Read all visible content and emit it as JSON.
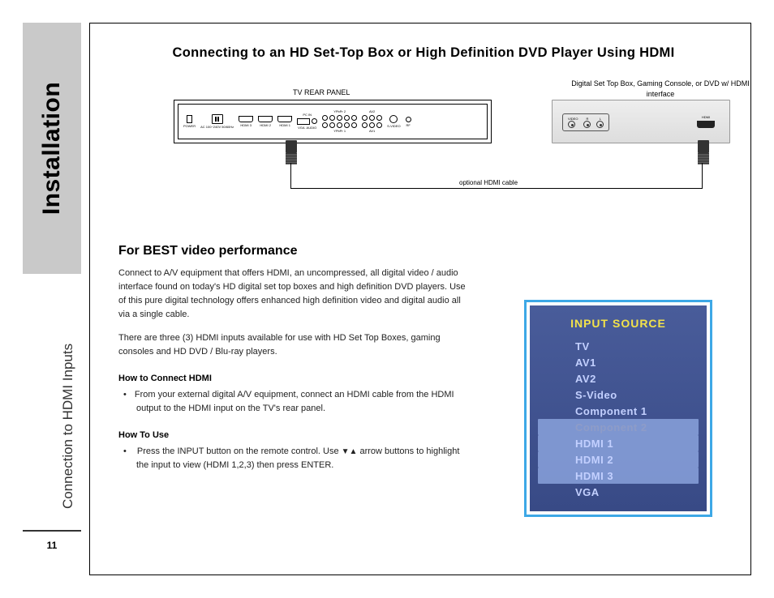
{
  "sidebar": {
    "chapter": "Installation",
    "subtitle": "Connection to HDMI Inputs",
    "page_number": "11"
  },
  "title": "Connecting to an HD Set-Top Box or High Definition DVD Player Using HDMI",
  "diagram": {
    "tv_label": "TV REAR PANEL",
    "tv_ports": {
      "power_switch": "POWER",
      "ac": "AC 100~240V 50/60Hz",
      "hdmi3": "HDMI 3",
      "hdmi2": "HDMI 2",
      "hdmi1": "HDMI 1",
      "vga": "VGA",
      "audio": "AUDIO",
      "pc_in": "PC IN",
      "ypbpr2": "YPbPr 2",
      "ypbpr1": "YPbPr 1",
      "av2": "AV2",
      "av1": "AV1",
      "svideo": "S-VIDEO",
      "rf": "RF"
    },
    "stb_label": "Digital Set Top Box, Gaming Console, or DVD w/ HDMI interface",
    "stb_ports": {
      "video": "VIDEO",
      "r": "R",
      "l": "L",
      "hdmi": "HDMI"
    },
    "cable_label": "optional HDMI cable"
  },
  "sections": {
    "best_video_heading": "For BEST video performance",
    "p1": "Connect to A/V equipment that offers HDMI, an uncompressed, all digital video / audio interface found on today's HD digital set top boxes and high definition DVD players. Use of this pure digital technology offers enhanced high definition video and digital audio all via a single cable.",
    "p2": "There are three (3) HDMI inputs available for use with HD Set Top Boxes, gaming consoles and HD DVD / Blu-ray players.",
    "how_connect_h": "How to Connect HDMI",
    "how_connect_b": "From your external digital A/V equipment, connect an HDMI cable from the HDMI output to the HDMI input on the TV's rear panel.",
    "how_use_h": "How To Use",
    "how_use_b_pre": "Press the INPUT button on the remote control. Use ",
    "how_use_arrows": "▼▲",
    "how_use_b_post": " arrow buttons to highlight the input to view (HDMI 1,2,3) then press ENTER."
  },
  "osd": {
    "title": "INPUT SOURCE",
    "items": [
      "TV",
      "AV1",
      "AV2",
      "S-Video",
      "Component 1",
      "Component 2",
      "HDMI 1",
      "HDMI 2",
      "HDMI 3",
      "VGA"
    ]
  }
}
